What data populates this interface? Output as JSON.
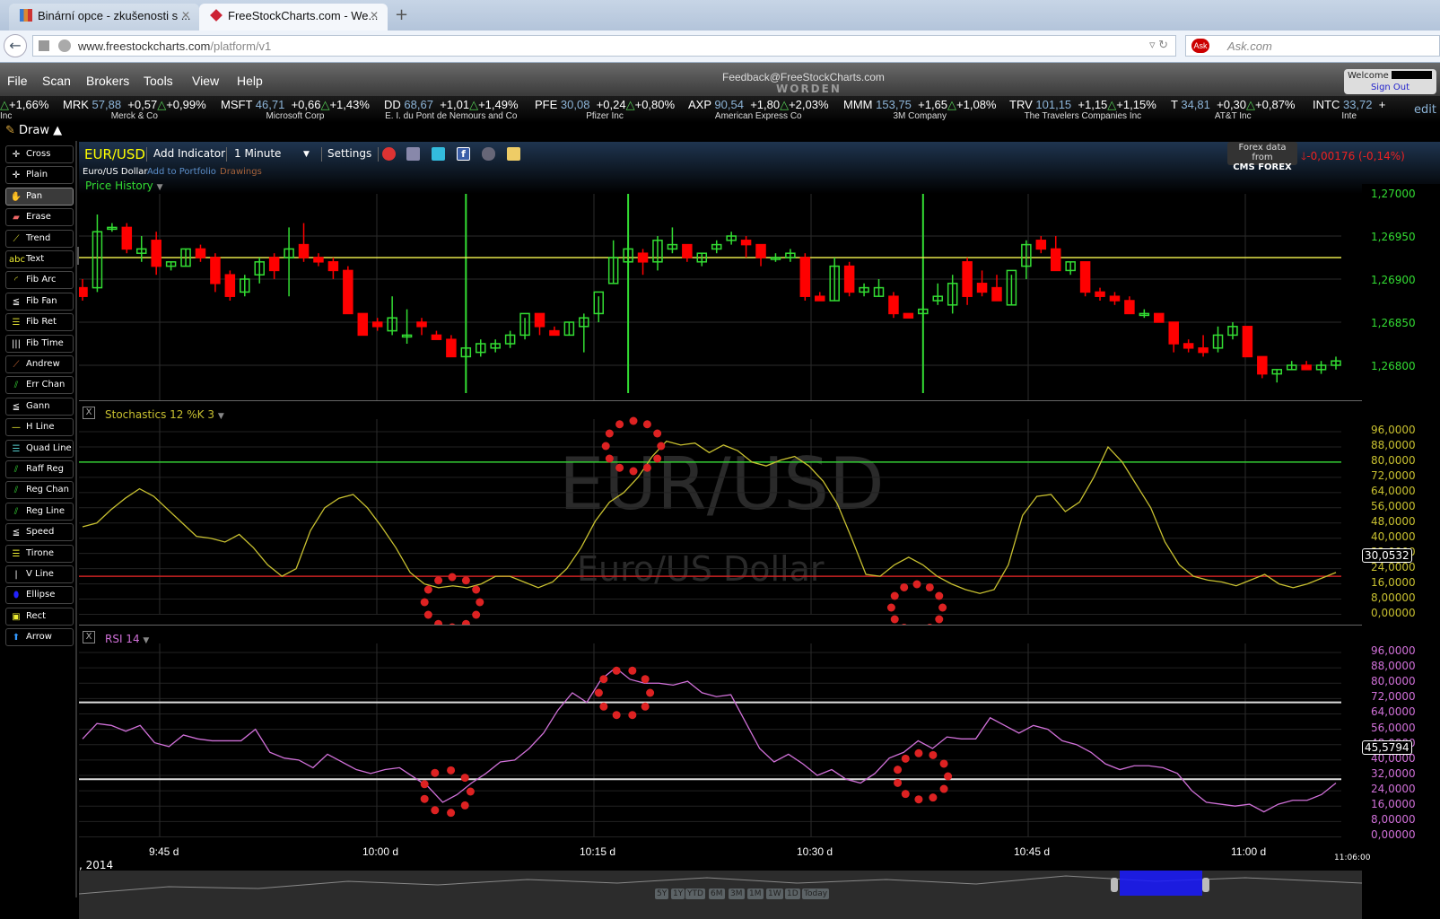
{
  "browser": {
    "tabs": [
      {
        "label": "Binární opce - zkušenosti s ...",
        "active": false
      },
      {
        "label": "FreeStockCharts.com - We...",
        "active": true
      }
    ],
    "url_domain": "www.freestockcharts.com",
    "url_path": "/platform/v1",
    "search_placeholder": "Ask.com"
  },
  "menu": {
    "items": [
      "File",
      "Scan",
      "Brokers",
      "Tools",
      "View",
      "Help"
    ],
    "feedback": "Feedback@FreeStockCharts.com",
    "brand": "WORDEN",
    "welcome": "Welcome",
    "signout": "Sign Out"
  },
  "ticker": {
    "lead": "+1,66%",
    "lead_name": "Inc",
    "edit": "edit",
    "items": [
      {
        "sym": "MRK",
        "price": "57,88",
        "chg": "+0,57",
        "pct": "+0,99%",
        "name": "Merck & Co"
      },
      {
        "sym": "MSFT",
        "price": "46,71",
        "chg": "+0,66",
        "pct": "+1,43%",
        "name": "Microsoft Corp"
      },
      {
        "sym": "DD",
        "price": "68,67",
        "chg": "+1,01",
        "pct": "+1,49%",
        "name": "E. I. du Pont de Nemours and Co"
      },
      {
        "sym": "PFE",
        "price": "30,08",
        "chg": "+0,24",
        "pct": "+0,80%",
        "name": "Pfizer Inc"
      },
      {
        "sym": "AXP",
        "price": "90,54",
        "chg": "+1,80",
        "pct": "+2,03%",
        "name": "American Express Co"
      },
      {
        "sym": "MMM",
        "price": "153,75",
        "chg": "+1,65",
        "pct": "+1,08%",
        "name": "3M Company"
      },
      {
        "sym": "TRV",
        "price": "101,15",
        "chg": "+1,15",
        "pct": "+1,15%",
        "name": "The Travelers Companies Inc"
      },
      {
        "sym": "T",
        "price": "34,81",
        "chg": "+0,30",
        "pct": "+0,87%",
        "name": "AT&T Inc"
      },
      {
        "sym": "INTC",
        "price": "33,72",
        "chg": "+",
        "pct": "",
        "name": "Inte"
      }
    ]
  },
  "toolbar": {
    "draw": "Draw",
    "chart_tab": "EUR/USD - 1 Minute"
  },
  "sidebar": {
    "tools": [
      "Cross",
      "Plain",
      "Pan",
      "Erase",
      "Trend",
      "Text",
      "Fib Arc",
      "Fib Fan",
      "Fib Ret",
      "Fib Time",
      "Andrew",
      "Err Chan",
      "Gann",
      "H Line",
      "Quad Line",
      "Raff Reg",
      "Reg Chan",
      "Reg Line",
      "Speed",
      "Tirone",
      "V Line",
      "Ellipse",
      "Rect",
      "Arrow"
    ],
    "selected": "Pan"
  },
  "chart_header": {
    "symbol": "EUR/USD",
    "add_indicator": "Add Indicator",
    "interval": "1 Minute",
    "settings": "Settings",
    "description": "Euro/US Dollar",
    "add_portfolio": "Add to Portfolio",
    "drawings": "Drawings",
    "price_history": "Price History",
    "forex_from": "Forex data from",
    "forex_brand": "CMS FOREX",
    "change": "-0,00176 (-0,14%)"
  },
  "watermark": {
    "symbol": "EUR/USD",
    "name": "Euro/US Dollar"
  },
  "colors": {
    "up": "#33dd33",
    "down": "#ff0000",
    "stoch": "#c8c030",
    "rsi": "#d070d8",
    "axis_price": "#33dd33",
    "axis_stoch": "#c8c030",
    "axis_rsi": "#d070d8"
  },
  "chart_data": [
    {
      "type": "candlestick",
      "title": "Price History",
      "ylim": [
        1.2678,
        1.2703
      ],
      "yticks": [
        "1,27000",
        "1,26950",
        "1,26900",
        "1,26850",
        "1,26800"
      ],
      "hline": 1.26925,
      "vlines_at_bar": [
        26,
        37,
        57
      ],
      "candles": [
        [
          1.2689,
          1.269,
          1.26875,
          1.2688
        ],
        [
          1.2689,
          1.26975,
          1.26885,
          1.26955
        ],
        [
          1.26958,
          1.26965,
          1.26955,
          1.2696
        ],
        [
          1.2696,
          1.26965,
          1.2693,
          1.26935
        ],
        [
          1.2693,
          1.2695,
          1.2692,
          1.26935
        ],
        [
          1.26945,
          1.26955,
          1.26905,
          1.26915
        ],
        [
          1.26915,
          1.2692,
          1.2691,
          1.2692
        ],
        [
          1.26915,
          1.26935,
          1.26915,
          1.26935
        ],
        [
          1.26935,
          1.2694,
          1.2692,
          1.26925
        ],
        [
          1.26925,
          1.2693,
          1.26885,
          1.26895
        ],
        [
          1.26905,
          1.2691,
          1.26875,
          1.2688
        ],
        [
          1.26885,
          1.26905,
          1.2688,
          1.269
        ],
        [
          1.26905,
          1.26925,
          1.26895,
          1.2692
        ],
        [
          1.26925,
          1.2693,
          1.269,
          1.2691
        ],
        [
          1.26925,
          1.2696,
          1.2688,
          1.26935
        ],
        [
          1.2694,
          1.26965,
          1.2692,
          1.26925
        ],
        [
          1.26925,
          1.2693,
          1.26915,
          1.2692
        ],
        [
          1.2692,
          1.26925,
          1.269,
          1.2691
        ],
        [
          1.2691,
          1.26915,
          1.2686,
          1.2686
        ],
        [
          1.2686,
          1.2686,
          1.2685,
          1.26835
        ],
        [
          1.2685,
          1.26855,
          1.2684,
          1.26845
        ],
        [
          1.2684,
          1.2688,
          1.26835,
          1.26855
        ],
        [
          1.26835,
          1.26865,
          1.26825,
          1.26835
        ],
        [
          1.2685,
          1.26855,
          1.26835,
          1.26845
        ],
        [
          1.26835,
          1.2684,
          1.2683,
          1.2683
        ],
        [
          1.2683,
          1.26835,
          1.26815,
          1.2681
        ],
        [
          1.2681,
          1.26825,
          1.26805,
          1.2682
        ],
        [
          1.26815,
          1.2683,
          1.2681,
          1.26825
        ],
        [
          1.2682,
          1.2683,
          1.26815,
          1.26825
        ],
        [
          1.26825,
          1.2684,
          1.2682,
          1.26835
        ],
        [
          1.26835,
          1.26855,
          1.2683,
          1.2686
        ],
        [
          1.2686,
          1.2686,
          1.26835,
          1.26845
        ],
        [
          1.2684,
          1.26845,
          1.26835,
          1.26835
        ],
        [
          1.26835,
          1.2685,
          1.26835,
          1.2685
        ],
        [
          1.26845,
          1.2686,
          1.26815,
          1.26855
        ],
        [
          1.2686,
          1.2688,
          1.2685,
          1.26885
        ],
        [
          1.26895,
          1.26945,
          1.26895,
          1.26925
        ],
        [
          1.2692,
          1.2694,
          1.26915,
          1.26935
        ],
        [
          1.2693,
          1.26935,
          1.26905,
          1.2692
        ],
        [
          1.2692,
          1.2695,
          1.2691,
          1.26945
        ],
        [
          1.26935,
          1.2696,
          1.2693,
          1.2694
        ],
        [
          1.2694,
          1.2694,
          1.2692,
          1.26925
        ],
        [
          1.2692,
          1.2693,
          1.26915,
          1.2693
        ],
        [
          1.26935,
          1.26945,
          1.2693,
          1.2694
        ],
        [
          1.26945,
          1.26955,
          1.2694,
          1.2695
        ],
        [
          1.26945,
          1.2695,
          1.26925,
          1.2694
        ],
        [
          1.2694,
          1.2694,
          1.26915,
          1.26925
        ],
        [
          1.26925,
          1.2693,
          1.2692,
          1.26925
        ],
        [
          1.26925,
          1.26935,
          1.2692,
          1.2693
        ],
        [
          1.26925,
          1.2693,
          1.26875,
          1.2688
        ],
        [
          1.2688,
          1.26885,
          1.26875,
          1.26875
        ],
        [
          1.26875,
          1.26925,
          1.26875,
          1.26915
        ],
        [
          1.26915,
          1.2692,
          1.2688,
          1.26885
        ],
        [
          1.26885,
          1.26895,
          1.2688,
          1.2689
        ],
        [
          1.2688,
          1.269,
          1.2688,
          1.2689
        ],
        [
          1.2688,
          1.26885,
          1.26855,
          1.2686
        ],
        [
          1.2686,
          1.2686,
          1.26855,
          1.26855
        ],
        [
          1.2686,
          1.2687,
          1.26855,
          1.26865
        ],
        [
          1.26875,
          1.26895,
          1.2687,
          1.2688
        ],
        [
          1.2687,
          1.26905,
          1.2686,
          1.26895
        ],
        [
          1.2692,
          1.26925,
          1.2687,
          1.2688
        ],
        [
          1.26895,
          1.2691,
          1.2688,
          1.26885
        ],
        [
          1.2689,
          1.26905,
          1.26875,
          1.26875
        ],
        [
          1.2687,
          1.26905,
          1.2687,
          1.2691
        ],
        [
          1.26915,
          1.26945,
          1.269,
          1.2694
        ],
        [
          1.26945,
          1.2695,
          1.2693,
          1.26935
        ],
        [
          1.26935,
          1.2695,
          1.2692,
          1.2691
        ],
        [
          1.2691,
          1.2692,
          1.26905,
          1.2692
        ],
        [
          1.2692,
          1.2692,
          1.2688,
          1.26885
        ],
        [
          1.26885,
          1.2689,
          1.26875,
          1.2688
        ],
        [
          1.2688,
          1.26885,
          1.2687,
          1.26875
        ],
        [
          1.26875,
          1.2688,
          1.2686,
          1.2686
        ],
        [
          1.2686,
          1.26865,
          1.26855,
          1.2686
        ],
        [
          1.2686,
          1.2686,
          1.2685,
          1.2685
        ],
        [
          1.2685,
          1.2685,
          1.26815,
          1.26825
        ],
        [
          1.26825,
          1.2683,
          1.26815,
          1.2682
        ],
        [
          1.2682,
          1.26835,
          1.2681,
          1.26815
        ],
        [
          1.2682,
          1.26845,
          1.26815,
          1.26835
        ],
        [
          1.26835,
          1.2685,
          1.2683,
          1.26845
        ],
        [
          1.26845,
          1.26845,
          1.2681,
          1.2681
        ],
        [
          1.2681,
          1.2681,
          1.26785,
          1.2679
        ],
        [
          1.2679,
          1.26795,
          1.2678,
          1.26795
        ],
        [
          1.26795,
          1.26805,
          1.26795,
          1.268
        ],
        [
          1.268,
          1.26805,
          1.26795,
          1.26795
        ],
        [
          1.26795,
          1.26805,
          1.2679,
          1.268
        ],
        [
          1.268,
          1.2681,
          1.26795,
          1.26805
        ]
      ],
      "axis_marker": null
    },
    {
      "type": "line",
      "title": "Stochastics 12 %K 3",
      "ylim": [
        0,
        100
      ],
      "yticks": [
        "96,0000",
        "88,0000",
        "80,0000",
        "72,0000",
        "64,0000",
        "56,0000",
        "48,0000",
        "40,0000",
        "32,0000",
        "24,0000",
        "16,0000",
        "8,00000",
        "0,00000"
      ],
      "upper_line": 80,
      "lower_line": 20,
      "current": "30,0532",
      "values": [
        46,
        48,
        55,
        61,
        66,
        62,
        55,
        48,
        41,
        40,
        38,
        42,
        35,
        26,
        20,
        24,
        44,
        56,
        61,
        63,
        56,
        46,
        35,
        22,
        16,
        14,
        15,
        14,
        16,
        20,
        20,
        17,
        14,
        17,
        24,
        35,
        49,
        59,
        64,
        72,
        83,
        91,
        89,
        90,
        85,
        89,
        86,
        80,
        78,
        81,
        83,
        78,
        70,
        58,
        40,
        21,
        20,
        26,
        30,
        26,
        20,
        16,
        13,
        11,
        13,
        26,
        52,
        62,
        63,
        54,
        59,
        72,
        88,
        80,
        68,
        56,
        38,
        26,
        20,
        18,
        17,
        15,
        18,
        21,
        16,
        14,
        16,
        19,
        22
      ],
      "highlight_dots": "red"
    },
    {
      "type": "line",
      "title": "RSI 14",
      "ylim": [
        0,
        100
      ],
      "yticks": [
        "96,0000",
        "88,0000",
        "80,0000",
        "72,0000",
        "64,0000",
        "56,0000",
        "48,0000",
        "40,0000",
        "32,0000",
        "24,0000",
        "16,0000",
        "8,00000",
        "0,00000"
      ],
      "upper_line": 70,
      "lower_line": 30,
      "current": "45,5794",
      "values": [
        51,
        59,
        58,
        55,
        58,
        49,
        47,
        53,
        51,
        50,
        50,
        50,
        56,
        44,
        41,
        40,
        36,
        43,
        39,
        35,
        33,
        35,
        36,
        31,
        26,
        18,
        22,
        28,
        33,
        39,
        40,
        46,
        54,
        66,
        75,
        70,
        82,
        88,
        82,
        80,
        80,
        79,
        81,
        75,
        73,
        74,
        60,
        46,
        39,
        43,
        38,
        32,
        35,
        30,
        28,
        33,
        41,
        44,
        50,
        46,
        52,
        51,
        51,
        62,
        58,
        54,
        58,
        56,
        50,
        48,
        44,
        38,
        35,
        37,
        37,
        36,
        33,
        24,
        18,
        17,
        16,
        17,
        13,
        17,
        19,
        19,
        22,
        28
      ],
      "highlight_dots": "red"
    }
  ],
  "time_axis": {
    "labels": [
      "9:45 d",
      "10:00 d",
      "10:15 d",
      "10:30 d",
      "10:45 d",
      "11:00 d"
    ],
    "date": ", 2014",
    "end_time": "11:06:00"
  },
  "range_buttons": [
    "5Y",
    "1Y",
    "YTD",
    "6M",
    "3M",
    "1M",
    "1W",
    "1D",
    "Today"
  ]
}
